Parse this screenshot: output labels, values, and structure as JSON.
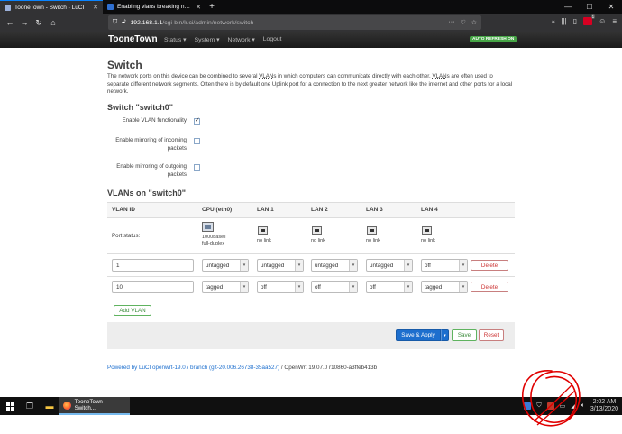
{
  "browser": {
    "tabs": [
      {
        "title": "TooneTown - Switch - LuCI",
        "active": true
      },
      {
        "title": "Enabling vlans breaking netwo",
        "active": false
      }
    ],
    "new_tab": "+",
    "url_host": "192.168.1.1",
    "url_path": "/cgi-bin/luci/admin/network/switch",
    "url_more": "···",
    "addon_badge": "1"
  },
  "luci": {
    "brand": "TooneTown",
    "menu": [
      "Status ▾",
      "System ▾",
      "Network ▾",
      "Logout"
    ],
    "auto_refresh": "AUTO REFRESH ON"
  },
  "page": {
    "title": "Switch",
    "description_parts": [
      "The network ports on this device can be combined to several ",
      "VLAN",
      "s in which computers can communicate directly with each other. ",
      "VLAN",
      "s are often used to separate different network segments. Often there is by default one Uplink port for a connection to the next greater network like the internet and other ports for a local network."
    ],
    "switch_heading": "Switch \"switch0\"",
    "options": [
      {
        "label": "Enable VLAN functionality",
        "checked": true
      },
      {
        "label": "Enable mirroring of incoming packets",
        "checked": false
      },
      {
        "label": "Enable mirroring of outgoing packets",
        "checked": false
      }
    ],
    "vlans_heading": "VLANs on \"switch0\"",
    "columns": [
      "VLAN ID",
      "CPU (eth0)",
      "LAN 1",
      "LAN 2",
      "LAN 3",
      "LAN 4"
    ],
    "port_status_label": "Port status:",
    "port_status": [
      {
        "line1": "1000baseT",
        "line2": "full-duplex"
      },
      {
        "line1": "no link",
        "line2": ""
      },
      {
        "line1": "no link",
        "line2": ""
      },
      {
        "line1": "no link",
        "line2": ""
      },
      {
        "line1": "no link",
        "line2": ""
      }
    ],
    "vlan_rows": [
      {
        "id": "1",
        "ports": [
          "untagged",
          "untagged",
          "untagged",
          "untagged",
          "off"
        ],
        "delete": "Delete"
      },
      {
        "id": "10",
        "ports": [
          "tagged",
          "off",
          "off",
          "off",
          "tagged"
        ],
        "delete": "Delete"
      }
    ],
    "add_vlan": "Add VLAN",
    "actions": {
      "save_apply": "Save & Apply",
      "save": "Save",
      "reset": "Reset"
    },
    "footer": {
      "link_text": "Powered by LuCI openwrt-19.07 branch (git-20.006.26738-35aa527)",
      "rest": " / OpenWrt 19.07.0 r10860-a3ffeb413b"
    }
  },
  "taskbar": {
    "app_label": "TooneTown - Switch...",
    "time": "2:02 AM",
    "date": "3/13/2020"
  },
  "colors": {
    "accent_blue": "#1d6fce",
    "save_green": "#46a546",
    "reset_red": "#cc3333",
    "scribble_red": "#e00000"
  }
}
